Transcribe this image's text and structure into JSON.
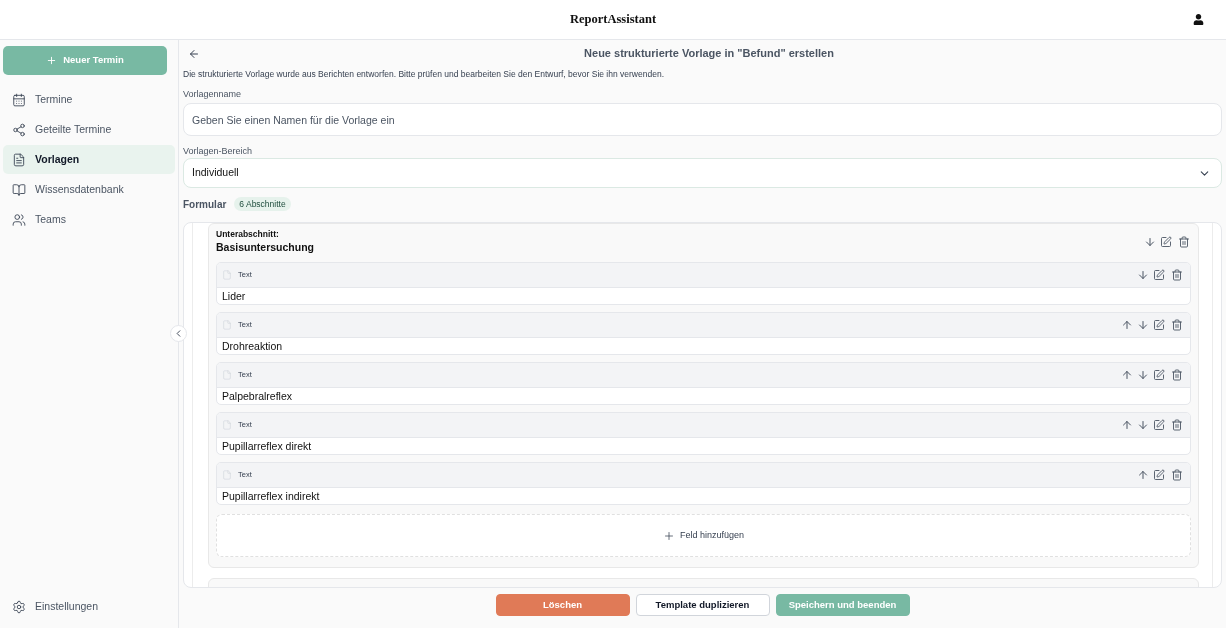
{
  "header": {
    "title": "ReportAssistant"
  },
  "sidebar": {
    "new_button": "Neuer Termin",
    "items": [
      {
        "label": "Termine",
        "selected": false
      },
      {
        "label": "Geteilte Termine",
        "selected": false
      },
      {
        "label": "Vorlagen",
        "selected": true
      },
      {
        "label": "Wissensdatenbank",
        "selected": false
      },
      {
        "label": "Teams",
        "selected": false
      }
    ],
    "footer_item": {
      "label": "Einstellungen"
    }
  },
  "page": {
    "title": "Neue strukturierte Vorlage in \"Befund\" erstellen",
    "description": "Die strukturierte Vorlage wurde aus Berichten entworfen. Bitte prüfen und bearbeiten Sie den Entwurf, bevor Sie ihn verwenden.",
    "name_field": {
      "label": "Vorlagenname",
      "placeholder": "Geben Sie einen Namen für die Vorlage ein"
    },
    "scope_field": {
      "label": "Vorlagen-Bereich",
      "value": "Individuell"
    }
  },
  "form": {
    "label": "Formular",
    "badge": "6 Abschnitte",
    "sections": [
      {
        "caption": "Unterabschnitt:",
        "title": "Basisuntersuchung",
        "move_up": false,
        "move_down": true,
        "fields": [
          {
            "type_label": "Text",
            "value": "Lider",
            "move_up": false,
            "move_down": true
          },
          {
            "type_label": "Text",
            "value": "Drohreaktion",
            "move_up": true,
            "move_down": true
          },
          {
            "type_label": "Text",
            "value": "Palpebralreflex",
            "move_up": true,
            "move_down": true
          },
          {
            "type_label": "Text",
            "value": "Pupillarreflex direkt",
            "move_up": true,
            "move_down": true
          },
          {
            "type_label": "Text",
            "value": "Pupillarreflex indirekt",
            "move_up": true,
            "move_down": false
          }
        ],
        "add_label": "Feld hinzufügen"
      }
    ]
  },
  "actions": [
    {
      "label": "Löschen",
      "kind": "danger"
    },
    {
      "label": "Template duplizieren",
      "kind": "secondary"
    },
    {
      "label": "Speichern und beenden",
      "kind": "primary"
    }
  ]
}
